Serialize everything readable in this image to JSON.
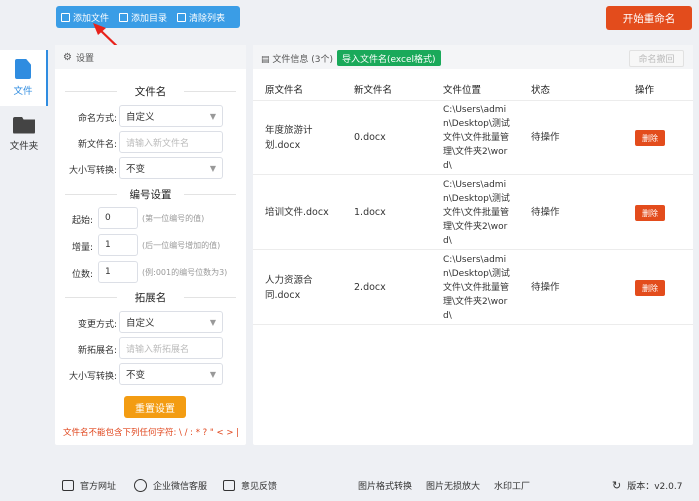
{
  "toolbar": {
    "add_file": "添加文件",
    "add_dir": "添加目录",
    "clear_list": "清除列表",
    "start": "开始重命名"
  },
  "sidebar": {
    "items": [
      {
        "label": "文件",
        "icon": "file-icon",
        "active": true
      },
      {
        "label": "文件夹",
        "icon": "folder-icon",
        "active": false
      }
    ]
  },
  "settings": {
    "header": "设置",
    "filename_section": "文件名",
    "naming_label": "命名方式:",
    "naming_value": "自定义",
    "new_name_label": "新文件名:",
    "new_name_placeholder": "请输入新文件名",
    "case_label": "大小写转换:",
    "case_value": "不变",
    "number_section": "编号设置",
    "start_label": "起始:",
    "start_value": "0",
    "start_hint": "(第一位编号的值)",
    "inc_label": "增量:",
    "inc_value": "1",
    "inc_hint": "(后一位编号增加的值)",
    "digits_label": "位数:",
    "digits_value": "1",
    "digits_hint": "(例:001的编号位数为3)",
    "ext_section": "拓展名",
    "ext_mode_label": "变更方式:",
    "ext_mode_value": "自定义",
    "new_ext_label": "新拓展名:",
    "new_ext_placeholder": "请输入新拓展名",
    "ext_case_label": "大小写转换:",
    "ext_case_value": "不变",
    "reset": "重置设置",
    "warning": "文件名不能包含下列任何字符: \\ / : * ? \" < > |"
  },
  "files": {
    "info_label": "文件信息",
    "count": "(3个)",
    "import_label": "导入文件名(excel格式)",
    "undo_label": "命名撤回",
    "columns": [
      "原文件名",
      "新文件名",
      "文件位置",
      "状态",
      "操作"
    ],
    "rows": [
      {
        "orig": "年度旅游计划.docx",
        "new": "0.docx",
        "loc": "C:\\Users\\admin\\Desktop\\测试文件\\文件批量管理\\文件夹2\\word\\",
        "status": "待操作",
        "action": "删除"
      },
      {
        "orig": "培训文件.docx",
        "new": "1.docx",
        "loc": "C:\\Users\\admin\\Desktop\\测试文件\\文件批量管理\\文件夹2\\word\\",
        "status": "待操作",
        "action": "删除"
      },
      {
        "orig": "人力资源合同.docx",
        "new": "2.docx",
        "loc": "C:\\Users\\admin\\Desktop\\测试文件\\文件批量管理\\文件夹2\\word\\",
        "status": "待操作",
        "action": "删除"
      }
    ]
  },
  "footer": {
    "website": "官方网址",
    "wechat": "企业微信客服",
    "feedback": "意见反馈",
    "img_convert": "图片格式转换",
    "img_enlarge": "图片无损放大",
    "watermark": "水印工厂",
    "version": "版本：v2.0.7"
  },
  "colors": {
    "primary": "#3a9de6",
    "start": "#e34c1c",
    "import": "#1aa95a",
    "reset": "#f39c12",
    "delete": "#e34c1c"
  }
}
